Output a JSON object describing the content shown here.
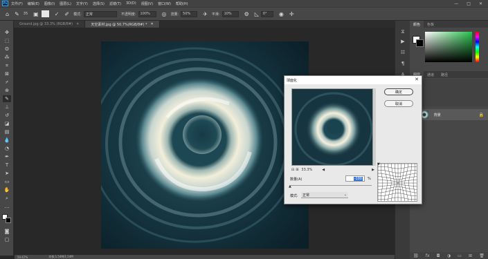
{
  "app": {
    "logo": "Ps"
  },
  "menu": [
    "文件(F)",
    "编辑(E)",
    "图像(I)",
    "图层(L)",
    "文字(Y)",
    "选择(S)",
    "滤镜(T)",
    "3D(D)",
    "视图(V)",
    "窗口(W)",
    "帮助(H)"
  ],
  "window_controls": [
    "—",
    "□",
    "✕"
  ],
  "options": {
    "size_value": "35",
    "mode_label": "模式:",
    "mode_value": "正常",
    "opacity_label": "不透明度:",
    "opacity_value": "100%",
    "flow_label": "流量:",
    "flow_value": "50%",
    "smooth_label": "平滑:",
    "smooth_value": "10%",
    "angle_value": "0°"
  },
  "tabs": [
    {
      "label": "Ground.jpg @ 33.3% (RGB/8#)",
      "active": false
    },
    {
      "label": "天空素材.jpg @ 50.7%(RGB/8#) *",
      "active": true
    }
  ],
  "status": {
    "zoom": "50.67%",
    "doc": "文档:1.54M/1.54M"
  },
  "panels": {
    "color_tabs": [
      "颜色",
      "色板"
    ],
    "color": {
      "fg": "#ffffff",
      "bg": "#000000",
      "hue_accent": "#27c24c"
    },
    "layer_tabs": [
      "图层",
      "通道",
      "路径"
    ],
    "layer_name": "背景"
  },
  "dialog": {
    "title": "球面化",
    "ok_label": "确定",
    "cancel_label": "取消",
    "zoom": "33.3%",
    "amount_label": "数量(A)",
    "amount_value": "-100",
    "amount_unit": "%",
    "amount_fraction": 0.0,
    "mode_label": "模式:",
    "mode_value": "正常"
  }
}
